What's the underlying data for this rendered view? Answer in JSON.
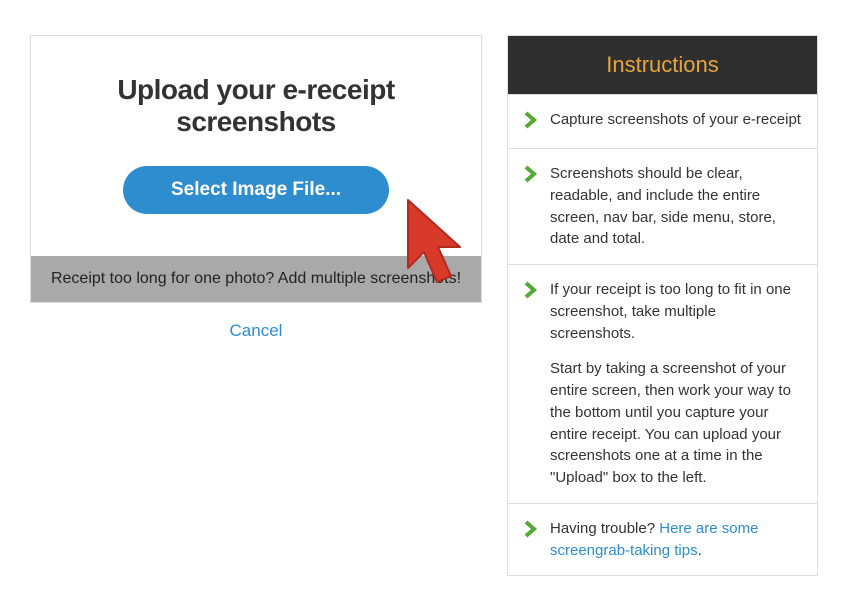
{
  "upload": {
    "title": "Upload your e-receipt screenshots",
    "select_button": "Select Image File...",
    "hint": "Receipt too long for one photo? Add multiple screenshots!",
    "cancel": "Cancel"
  },
  "instructions": {
    "header": "Instructions",
    "items": [
      {
        "text": "Capture screenshots of your e-receipt"
      },
      {
        "text": "Screenshots should be clear, readable, and include the entire screen, nav bar, side menu, store, date and total."
      },
      {
        "text": "If your receipt is too long to fit in one screenshot, take multiple screenshots.",
        "text2": "Start by taking a screenshot of your entire screen, then work your way to the bottom until you capture your entire receipt. You can upload your screenshots one at a time in the \"Upload\" box to the left."
      },
      {
        "prefix": "Having trouble? ",
        "link": "Here are some screengrab-taking tips",
        "suffix": "."
      }
    ]
  }
}
